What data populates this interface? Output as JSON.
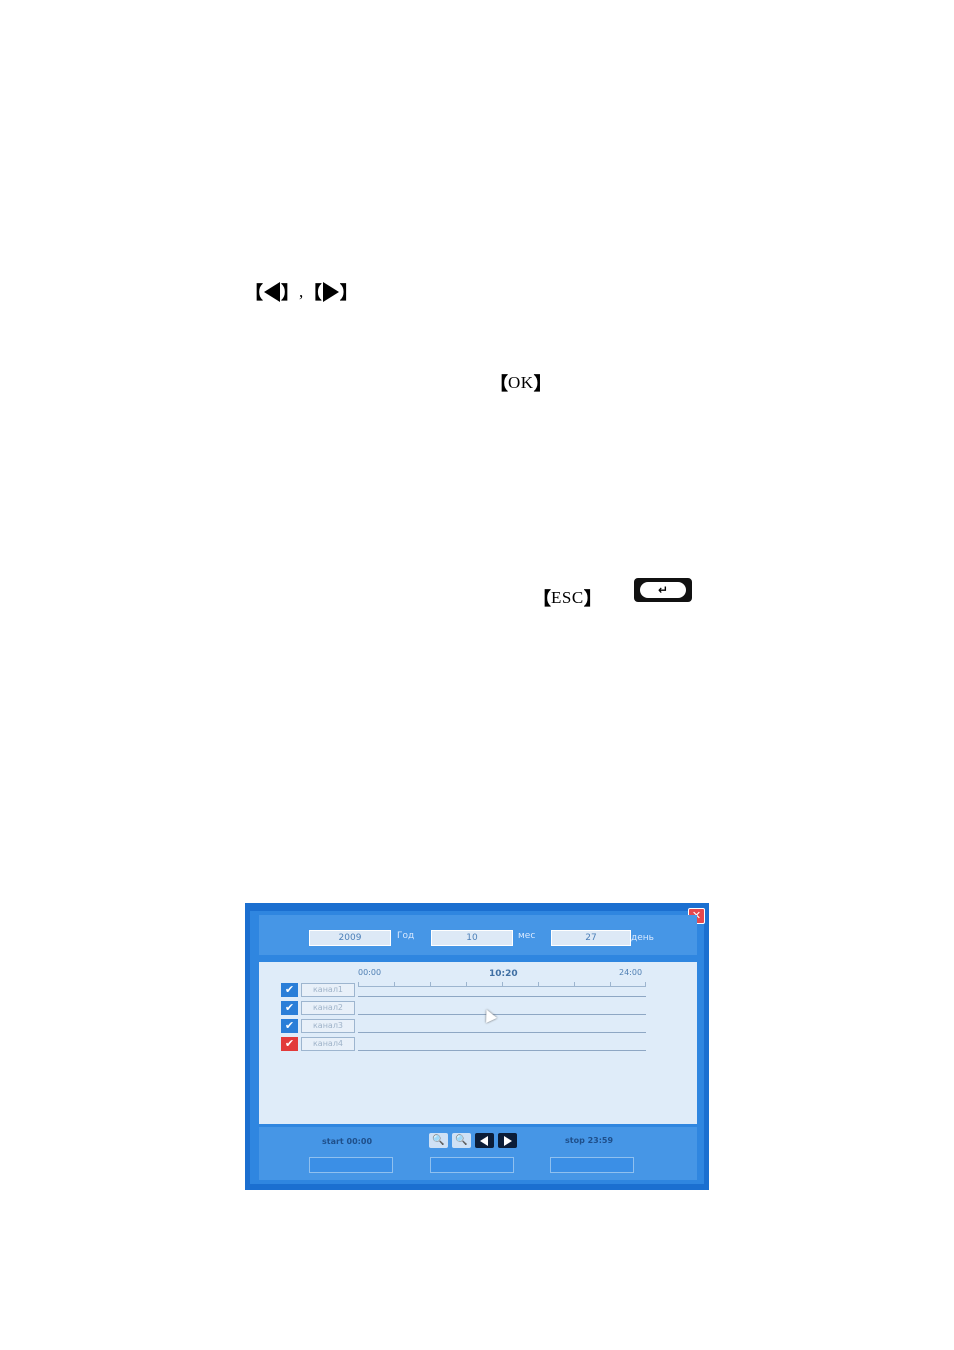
{
  "keys": {
    "arrows_separator": ",",
    "ok": "OK",
    "esc": "ESC",
    "return_key_glyph": "↵"
  },
  "dvr_window": {
    "close_glyph": "✕",
    "date": {
      "year_value": "2009",
      "year_label": "Год",
      "month_value": "10",
      "month_label": "мес",
      "day_value": "27",
      "day_label": "день"
    },
    "timeline": {
      "start_time": "00:00",
      "current_time": "10:20",
      "end_time": "24:00"
    },
    "channels": [
      {
        "label": "канал1",
        "checked": true,
        "color": "#2a7ed8"
      },
      {
        "label": "канал2",
        "checked": true,
        "color": "#2a7ed8"
      },
      {
        "label": "канал3",
        "checked": true,
        "color": "#2a7ed8"
      },
      {
        "label": "канал4",
        "checked": true,
        "color": "#e23a3a"
      }
    ],
    "check_glyph": "✔",
    "bottom": {
      "start_label": "start 00:00",
      "stop_label": "stop 23:59"
    }
  }
}
